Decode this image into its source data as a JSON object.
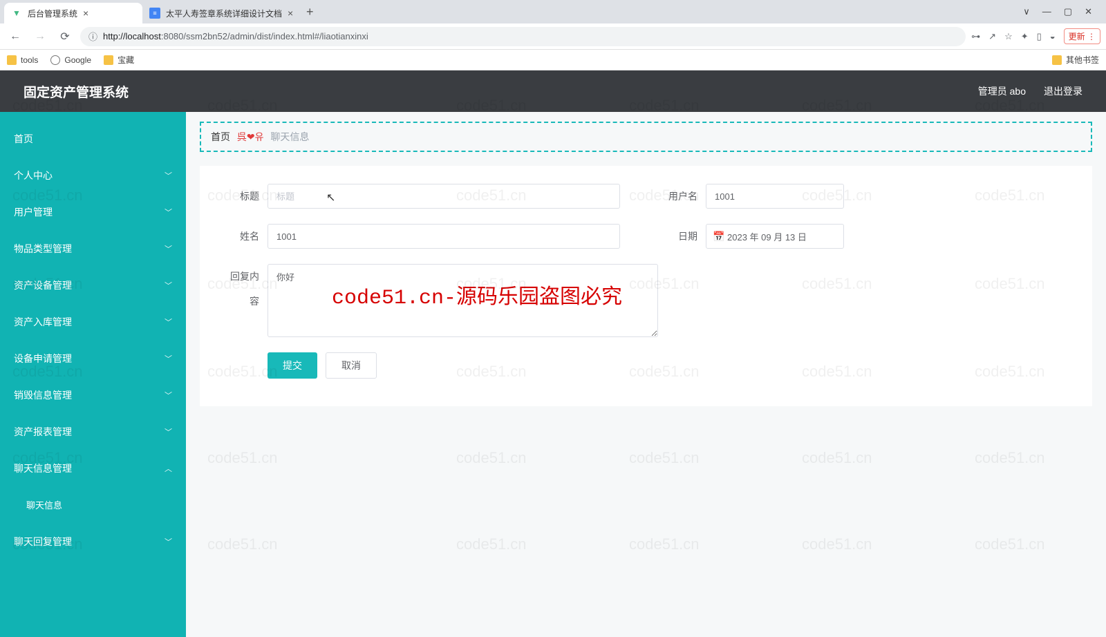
{
  "browser": {
    "tabs": [
      {
        "title": "后台管理系统",
        "active": true
      },
      {
        "title": "太平人寿签章系统详细设计文档",
        "active": false
      }
    ],
    "url_prefix": "http://",
    "url_host": "localhost",
    "url_port": ":8080",
    "url_path": "/ssm2bn52/admin/dist/index.html#/liaotianxinxi",
    "bookmarks": {
      "tools": "tools",
      "google": "Google",
      "baozang": "宝藏",
      "other": "其他书签"
    },
    "more": "更新",
    "win": {
      "min": "—",
      "max": "▢",
      "close": "✕",
      "restore": "∨"
    }
  },
  "header": {
    "title": "固定资产管理系统",
    "admin": "管理员 abo",
    "logout": "退出登录"
  },
  "sidebar": {
    "items": [
      {
        "label": "首页",
        "hasChevron": false
      },
      {
        "label": "个人中心",
        "hasChevron": true,
        "down": true
      },
      {
        "label": "用户管理",
        "hasChevron": true,
        "down": true
      },
      {
        "label": "物品类型管理",
        "hasChevron": true,
        "down": true
      },
      {
        "label": "资产设备管理",
        "hasChevron": true,
        "down": true
      },
      {
        "label": "资产入库管理",
        "hasChevron": true,
        "down": true
      },
      {
        "label": "设备申请管理",
        "hasChevron": true,
        "down": true
      },
      {
        "label": "销毁信息管理",
        "hasChevron": true,
        "down": true
      },
      {
        "label": "资产报表管理",
        "hasChevron": true,
        "down": true
      },
      {
        "label": "聊天信息管理",
        "hasChevron": true,
        "down": false
      },
      {
        "label": "聊天信息",
        "hasChevron": false,
        "sub": true
      },
      {
        "label": "聊天回复管理",
        "hasChevron": true,
        "down": true
      }
    ]
  },
  "breadcrumb": {
    "home": "首页",
    "heart": "呉❤유",
    "current": "聊天信息"
  },
  "form": {
    "title_label": "标题",
    "title_placeholder": "标题",
    "title_value": "",
    "username_label": "用户名",
    "username_value": "1001",
    "name_label": "姓名",
    "name_value": "1001",
    "date_label": "日期",
    "date_value": "2023 年 09 月 13 日",
    "reply_label": "回复内容",
    "reply_value": "你好",
    "submit": "提交",
    "cancel": "取消"
  },
  "watermark": "code51.cn-源码乐园盗图必究",
  "bg_wm": "code51.cn"
}
